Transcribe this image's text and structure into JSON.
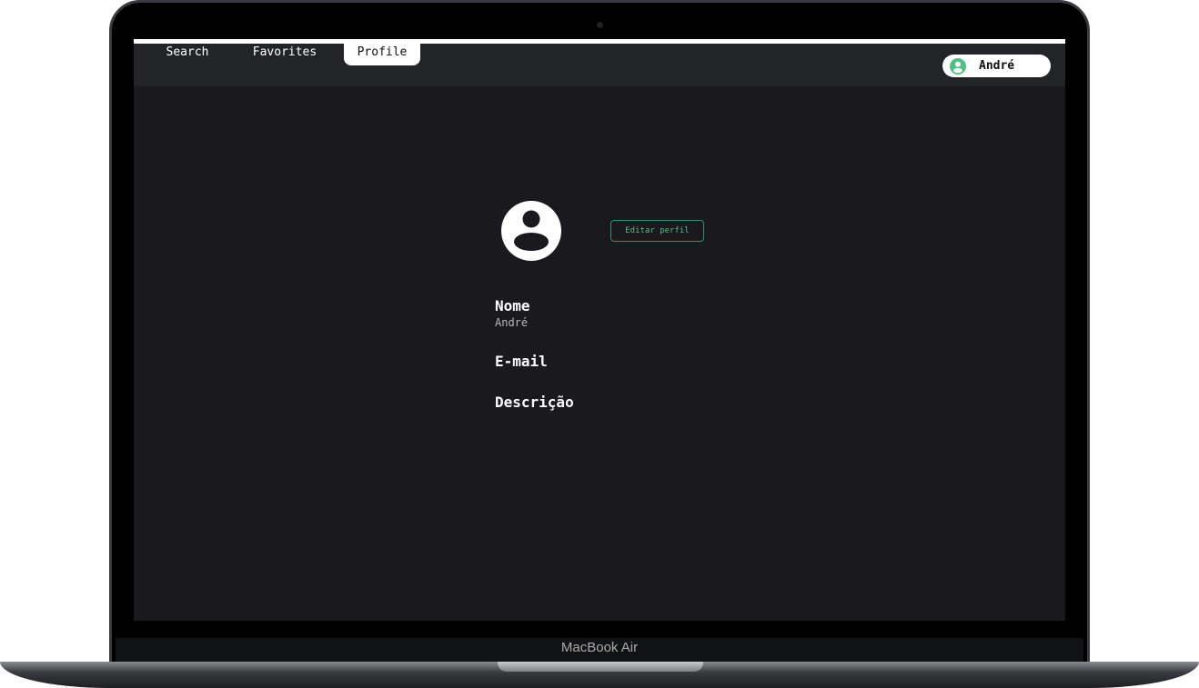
{
  "device": {
    "brand_label": "MacBook Air"
  },
  "nav": {
    "tabs": [
      {
        "label": "Search"
      },
      {
        "label": "Favorites"
      },
      {
        "label": "Profile",
        "active": true
      }
    ]
  },
  "user": {
    "name": "André",
    "icon": "account-circle-icon",
    "accent": "#4fbf86"
  },
  "profile": {
    "edit_label": "Editar perfil",
    "fields": [
      {
        "label": "Nome",
        "value": "André"
      },
      {
        "label": "E-mail",
        "value": ""
      },
      {
        "label": "Descrição",
        "value": ""
      }
    ]
  }
}
